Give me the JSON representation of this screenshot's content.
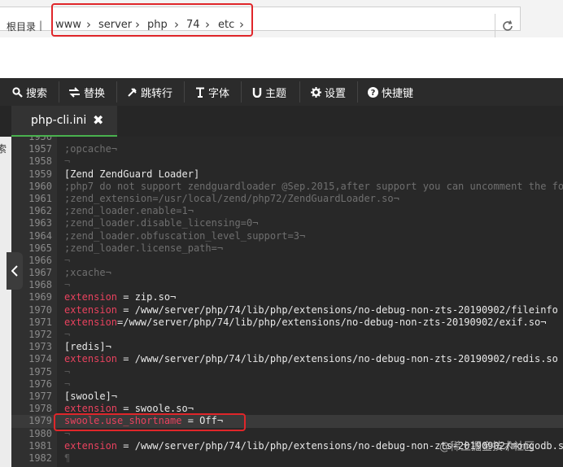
{
  "breadcrumb": {
    "root_label": "根目录",
    "segments": [
      "www",
      "server",
      "php",
      "74",
      "etc"
    ]
  },
  "toolbar": {
    "items": [
      {
        "label": "搜索",
        "icon": "search-icon"
      },
      {
        "label": "替换",
        "icon": "replace-icon"
      },
      {
        "label": "跳转行",
        "icon": "jump-line-icon"
      },
      {
        "label": "字体",
        "icon": "font-icon"
      },
      {
        "label": "主题",
        "icon": "theme-icon"
      },
      {
        "label": "设置",
        "icon": "gear-icon"
      },
      {
        "label": "快捷键",
        "icon": "help-icon"
      }
    ]
  },
  "tabs": [
    {
      "label": "php-cli.ini"
    }
  ],
  "side": {
    "text": "索"
  },
  "editor": {
    "lines": [
      {
        "num": "1956",
        "text": "",
        "kind": "comment"
      },
      {
        "num": "1957",
        "text": ";opcache¬",
        "kind": "comment"
      },
      {
        "num": "1958",
        "text": "¬",
        "kind": "inv"
      },
      {
        "num": "1959",
        "text": "[Zend ZendGuard Loader]",
        "kind": "section"
      },
      {
        "num": "1960",
        "text": ";php7 do not support zendguardloader @Sep.2015,after support you can uncomment the fo",
        "kind": "comment"
      },
      {
        "num": "1961",
        "text": ";zend_extension=/usr/local/zend/php72/ZendGuardLoader.so¬",
        "kind": "comment"
      },
      {
        "num": "1962",
        "text": ";zend_loader.enable=1¬",
        "kind": "comment"
      },
      {
        "num": "1963",
        "text": ";zend_loader.disable_licensing=0¬",
        "kind": "comment"
      },
      {
        "num": "1964",
        "text": ";zend_loader.obfuscation_level_support=3¬",
        "kind": "comment"
      },
      {
        "num": "1965",
        "text": ";zend_loader.license_path=¬",
        "kind": "comment"
      },
      {
        "num": "1966",
        "text": "¬",
        "kind": "inv"
      },
      {
        "num": "1967",
        "text": ";xcache¬",
        "kind": "comment"
      },
      {
        "num": "1968",
        "text": "¬",
        "kind": "inv"
      },
      {
        "num": "1969",
        "key": "extension",
        "rest": " = zip.so¬",
        "kind": "kv"
      },
      {
        "num": "1970",
        "key": "extension",
        "rest": " = /www/server/php/74/lib/php/extensions/no-debug-non-zts-20190902/fileinfo",
        "kind": "kv"
      },
      {
        "num": "1971",
        "key": "extension",
        "rest": "=/www/server/php/74/lib/php/extensions/no-debug-non-zts-20190902/exif.so¬",
        "kind": "kv"
      },
      {
        "num": "1972",
        "text": "¬",
        "kind": "inv"
      },
      {
        "num": "1973",
        "text": "[redis]¬",
        "kind": "section"
      },
      {
        "num": "1974",
        "key": "extension",
        "rest": " = /www/server/php/74/lib/php/extensions/no-debug-non-zts-20190902/redis.so",
        "kind": "kv"
      },
      {
        "num": "1975",
        "text": "¬",
        "kind": "inv"
      },
      {
        "num": "1976",
        "text": "¬",
        "kind": "inv"
      },
      {
        "num": "1977",
        "text": "[swoole]¬",
        "kind": "section"
      },
      {
        "num": "1978",
        "key": "extension",
        "rest": " = swoole.so¬",
        "kind": "kv"
      },
      {
        "num": "1979",
        "key": "swoole.use_shortname",
        "rest": " = Off¬",
        "kind": "kv",
        "active": true
      },
      {
        "num": "1980",
        "text": "¬",
        "kind": "inv"
      },
      {
        "num": "1981",
        "key": "extension",
        "rest": " = /www/server/php/74/lib/php/extensions/no-debug-non-zts-20190902/mongodb.s",
        "kind": "kv"
      },
      {
        "num": "1982",
        "text": "¶",
        "kind": "inv"
      }
    ]
  },
  "watermark": "@稀土掘金技术社区",
  "colors": {
    "highlight_box": "#e0262a",
    "key": "#e8425e",
    "active_tab_underline": "#49b14e"
  }
}
